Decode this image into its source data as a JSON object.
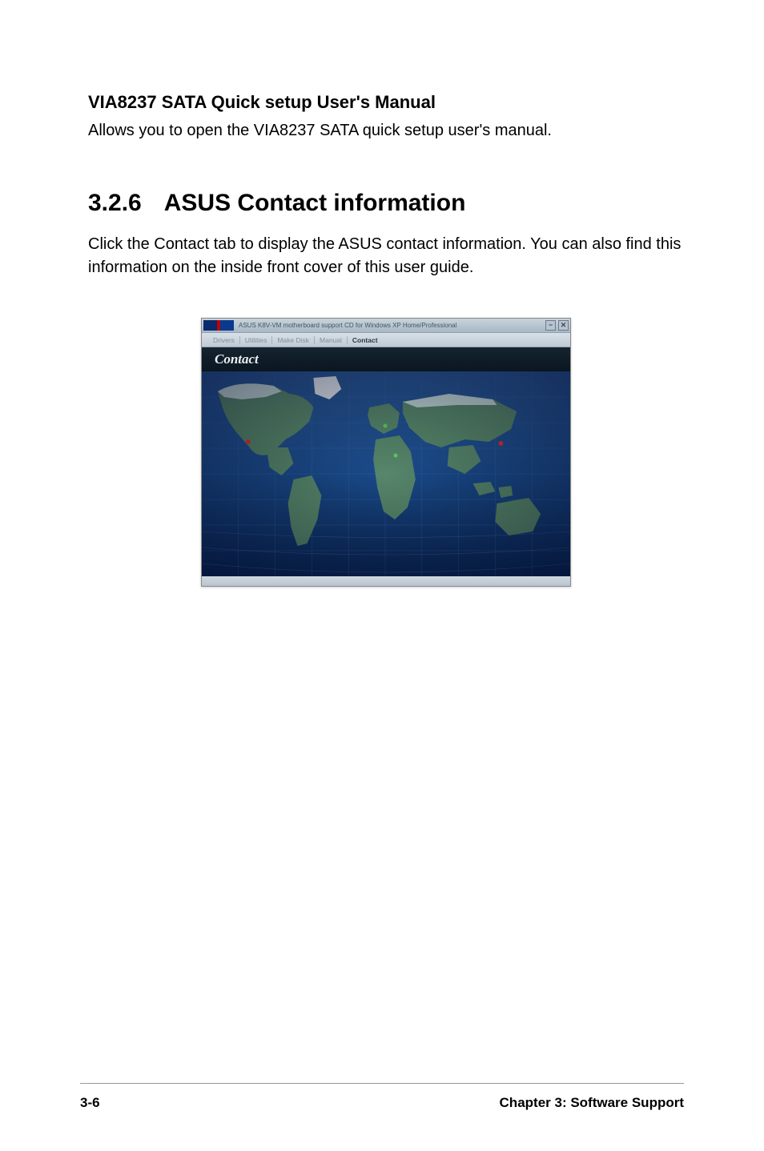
{
  "subsection": {
    "title": "VIA8237 SATA Quick setup User's Manual",
    "body": "Allows you to open the VIA8237 SATA quick setup user's manual."
  },
  "section": {
    "number": "3.2.6",
    "title": "ASUS Contact information",
    "body": "Click the Contact tab to display the ASUS contact information. You can also find this information on the inside front cover of this user guide."
  },
  "app_window": {
    "titlebar": "ASUS K8V-VM motherboard support CD for Windows XP Home/Professional",
    "tabs": [
      "Drivers",
      "Utilities",
      "Make Disk",
      "Manual",
      "Contact"
    ],
    "active_tab_index": 4,
    "content_header": "Contact",
    "buttons": {
      "minimize": "−",
      "close": "✕"
    }
  },
  "footer": {
    "page": "3-6",
    "chapter": "Chapter 3: Software Support"
  }
}
